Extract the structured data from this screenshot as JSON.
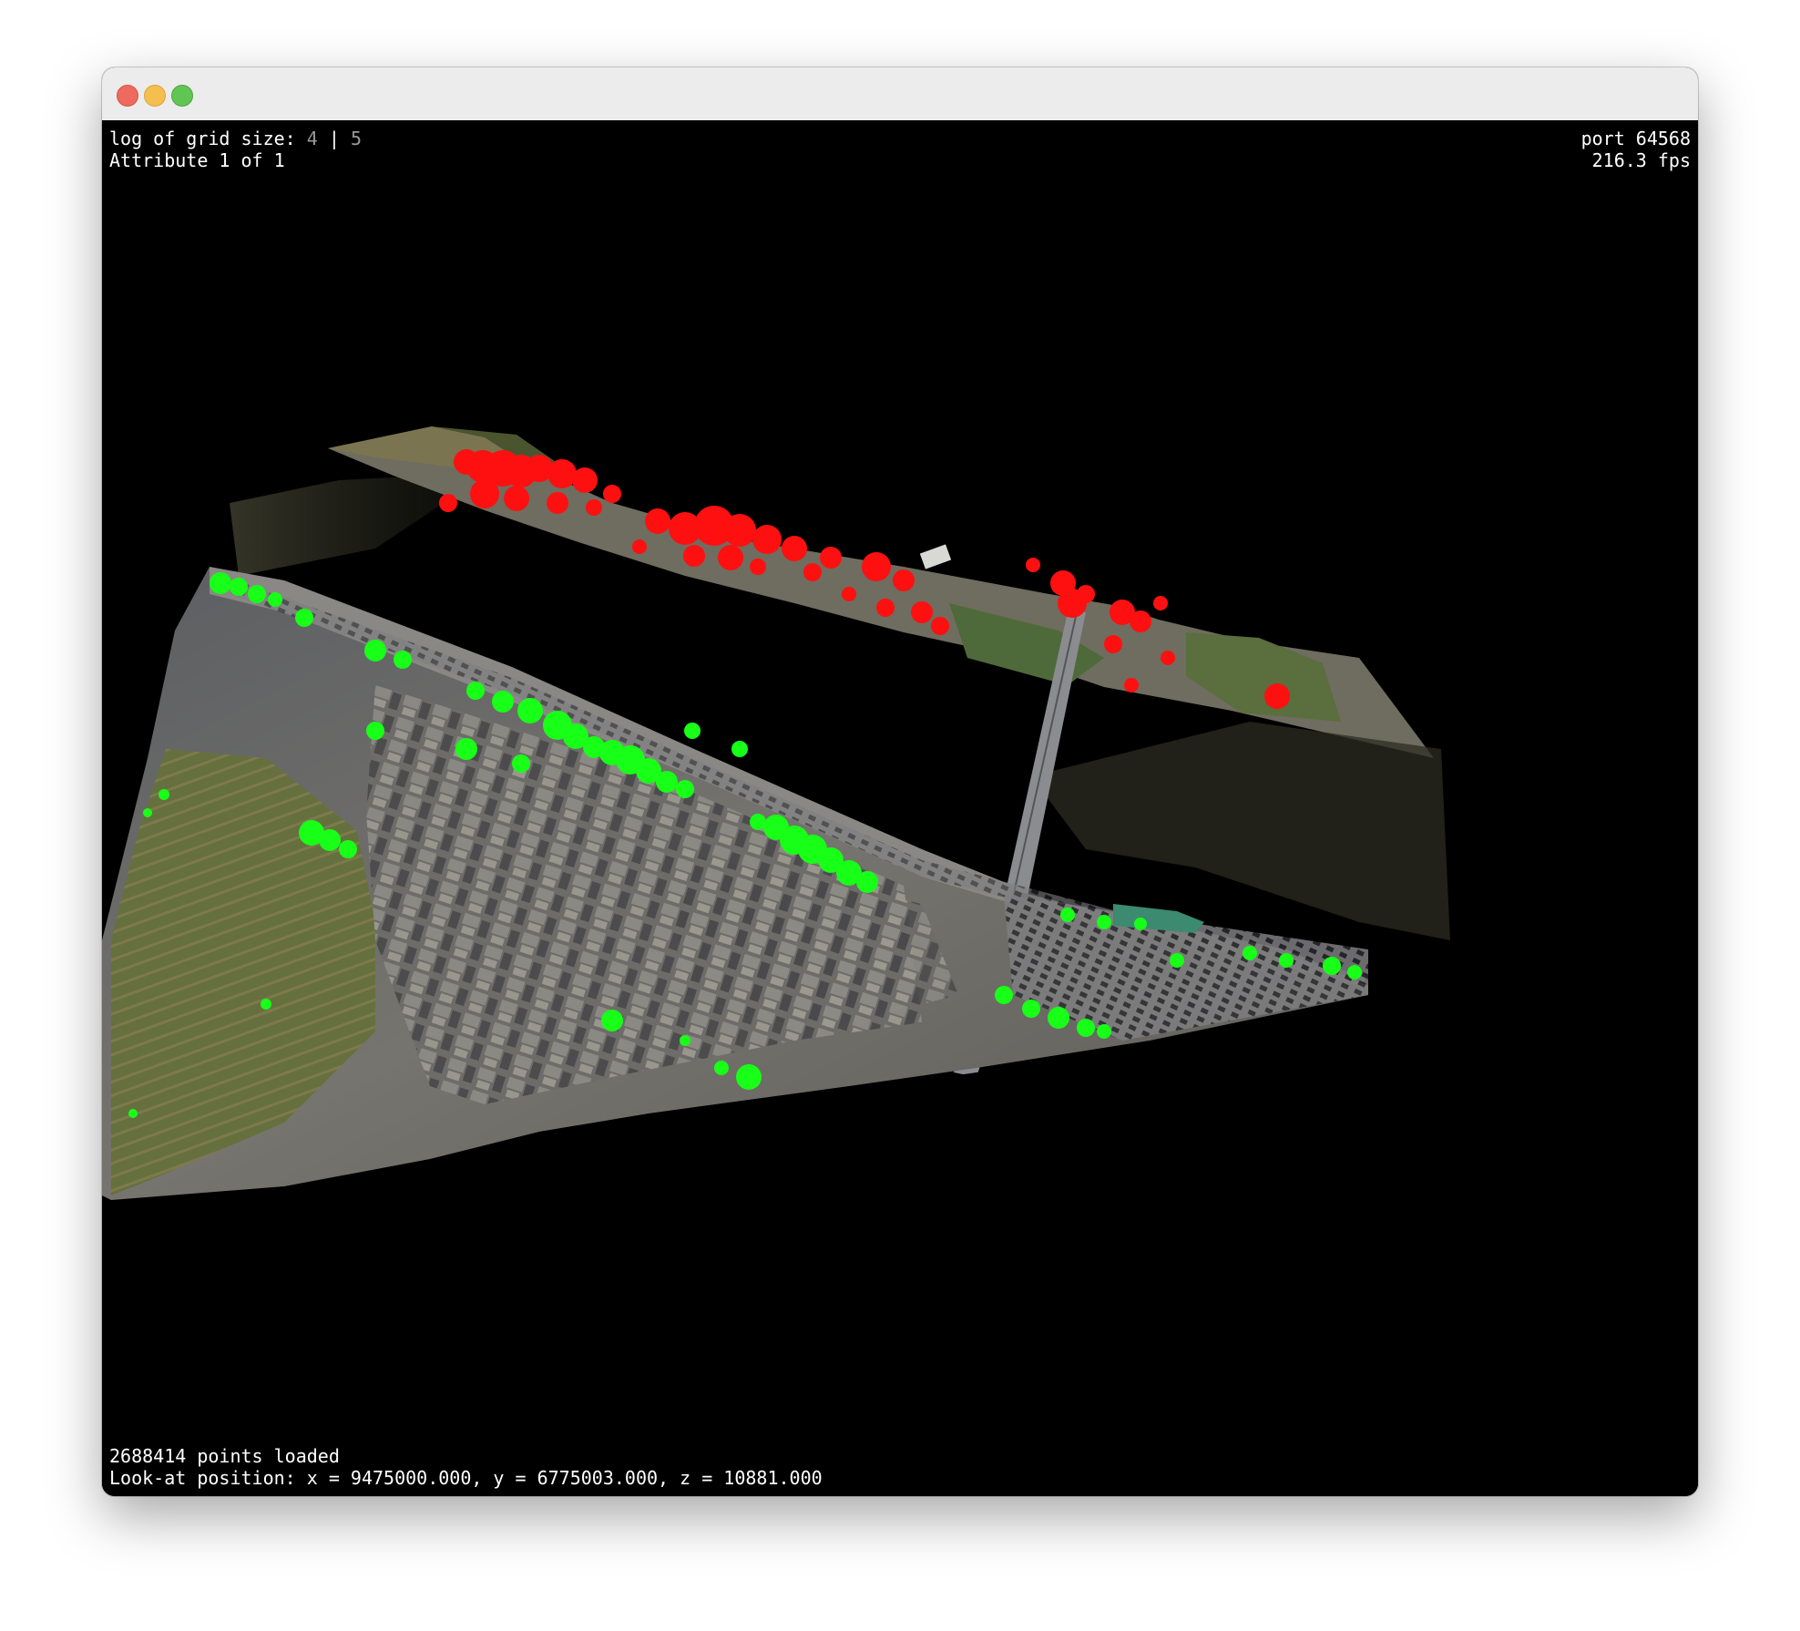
{
  "hud": {
    "grid_label": "log of grid size:",
    "grid_value_a": "4",
    "grid_separator": "|",
    "grid_value_b": "5",
    "attribute_text": "Attribute 1 of 1",
    "port_text": "port 64568",
    "fps_text": "216.3 fps",
    "points_text": "2688414 points loaded",
    "lookat_text": "Look-at position: x = 9475000.000, y = 6775003.000, z = 10881.000"
  },
  "colors": {
    "background": "#000000",
    "class_red": "#ff1010",
    "class_green": "#18ff18",
    "hud_text": "#ffffff"
  },
  "scene": {
    "content": "3D point cloud of a riverside town viewed obliquely from above"
  }
}
